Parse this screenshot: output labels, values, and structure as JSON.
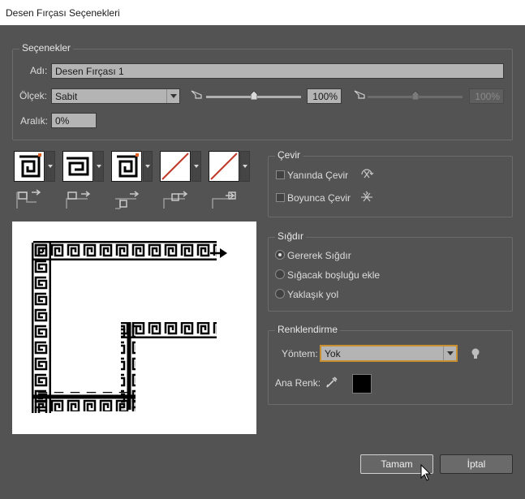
{
  "window": {
    "title": "Desen Fırçası Seçenekleri"
  },
  "options": {
    "legend": "Seçenekler",
    "name_label": "Adı:",
    "name_value": "Desen Fırçası 1",
    "scale_label": "Ölçek:",
    "scale_select": "Sabit",
    "scale_min_value": "100%",
    "scale_max_value": "100%",
    "spacing_label": "Aralık:",
    "spacing_value": "0%"
  },
  "flip": {
    "legend": "Çevir",
    "along_label": "Yanında Çevir",
    "across_label": "Boyunca Çevir"
  },
  "fit": {
    "legend": "Sığdır",
    "options": [
      "Gererek Sığdır",
      "Sığacak boşluğu ekle",
      "Yaklaşık yol"
    ],
    "selected": 0
  },
  "colorization": {
    "legend": "Renklendirme",
    "method_label": "Yöntem:",
    "method_value": "Yok",
    "key_color_label": "Ana Renk:",
    "key_color": "#000000"
  },
  "buttons": {
    "ok": "Tamam",
    "cancel": "İptal"
  },
  "colors": {
    "dialog_bg": "#535353",
    "field_bg": "#b4b4b4",
    "highlight": "#c8902e",
    "none_red": "#c0392b"
  }
}
